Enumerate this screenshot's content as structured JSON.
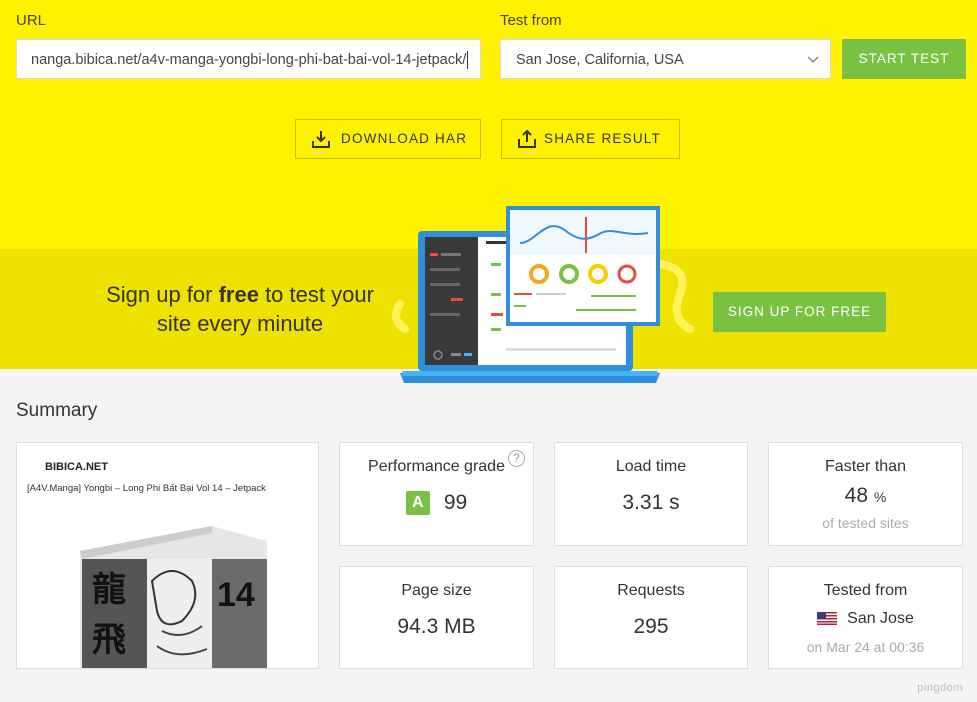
{
  "form": {
    "url_label": "URL",
    "url_value": "nanga.bibica.net/a4v-manga-yongbi-long-phi-bat-bai-vol-14-jetpack/",
    "test_from_label": "Test from",
    "test_from_value": "San Jose, California, USA",
    "start_label": "START TEST"
  },
  "actions": {
    "download_label": "DOWNLOAD HAR",
    "share_label": "SHARE RESULT"
  },
  "promo": {
    "text_before": "Sign up for ",
    "text_bold": "free",
    "text_after": " to test your site every minute",
    "signup_label": "SIGN UP FOR FREE"
  },
  "summary": {
    "title": "Summary",
    "screenshot": {
      "site_name": "BIBICA.NET",
      "page_title": "[A4V.Manga] Yongbi – Long Phi Bất Bại Vol 14 – Jetpack",
      "volume": "14"
    },
    "performance": {
      "label": "Performance grade",
      "grade": "A",
      "score": "99",
      "help": "?"
    },
    "load_time": {
      "label": "Load time",
      "value": "3.31 s"
    },
    "faster_than": {
      "label": "Faster than",
      "value": "48",
      "unit": "%",
      "sub": "of tested sites"
    },
    "page_size": {
      "label": "Page size",
      "value": "94.3 MB"
    },
    "requests": {
      "label": "Requests",
      "value": "295"
    },
    "tested_from": {
      "label": "Tested from",
      "location": "San Jose",
      "date": "on Mar 24 at 00:36"
    }
  },
  "brand": "pingdom",
  "colors": {
    "yellow": "#fff200",
    "green": "#7ac143",
    "laptop_blue": "#2f8fdc"
  }
}
